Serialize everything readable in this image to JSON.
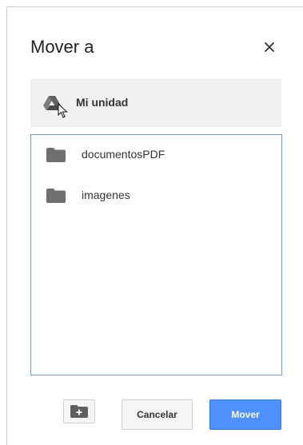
{
  "dialog": {
    "title": "Mover a",
    "close_icon": "close-icon"
  },
  "breadcrumb": {
    "icon": "drive-icon",
    "label": "Mi unidad"
  },
  "folders": [
    {
      "name": "documentosPDF",
      "icon": "folder-icon"
    },
    {
      "name": "imagenes",
      "icon": "folder-icon"
    }
  ],
  "actions": {
    "new_folder_icon": "new-folder-icon",
    "cancel_label": "Cancelar",
    "move_label": "Mover"
  },
  "colors": {
    "primary": "#4d90fe",
    "list_border": "#6f9be6",
    "folder": "#6f6f6f",
    "breadcrumb_bg": "#f1f1f1"
  }
}
